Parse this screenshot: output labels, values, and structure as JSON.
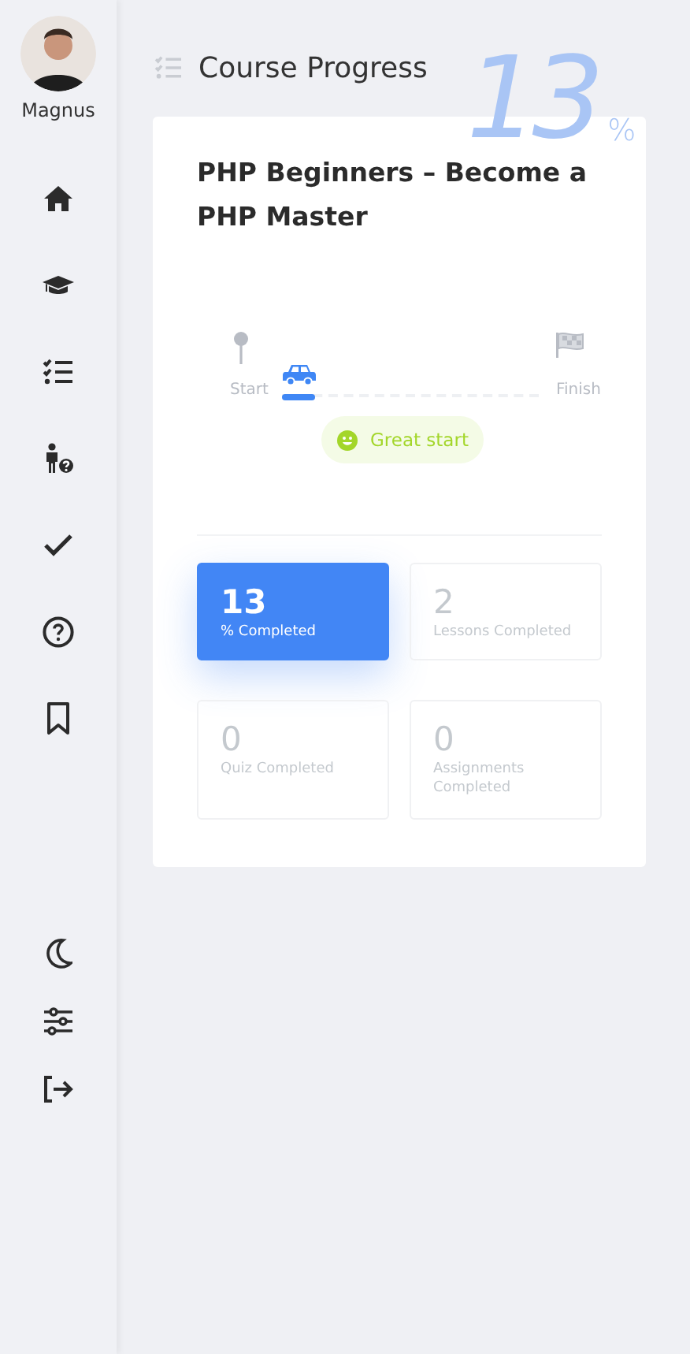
{
  "user": {
    "name": "Magnus"
  },
  "nav": [
    {
      "kind": "home"
    },
    {
      "kind": "courses"
    },
    {
      "kind": "progress"
    },
    {
      "kind": "help-person"
    },
    {
      "kind": "check"
    },
    {
      "kind": "question"
    },
    {
      "kind": "bookmark"
    }
  ],
  "bottom_nav": [
    {
      "kind": "moon"
    },
    {
      "kind": "sliders"
    },
    {
      "kind": "logout"
    }
  ],
  "page": {
    "title": "Course Progress",
    "watermark": "13",
    "watermark_unit": "%"
  },
  "course": {
    "title": "PHP Beginners – Become a PHP Master",
    "progress": {
      "start_label": "Start",
      "finish_label": "Finish",
      "level": 0.13,
      "badge": "Great start"
    },
    "stats": [
      {
        "value": "13",
        "label": "% Completed",
        "selected": true
      },
      {
        "value": "2",
        "label": "Lessons Completed",
        "selected": false
      },
      {
        "value": "0",
        "label": "Quiz Completed",
        "selected": false
      },
      {
        "value": "0",
        "label": "Assignments Completed",
        "selected": false
      }
    ]
  }
}
